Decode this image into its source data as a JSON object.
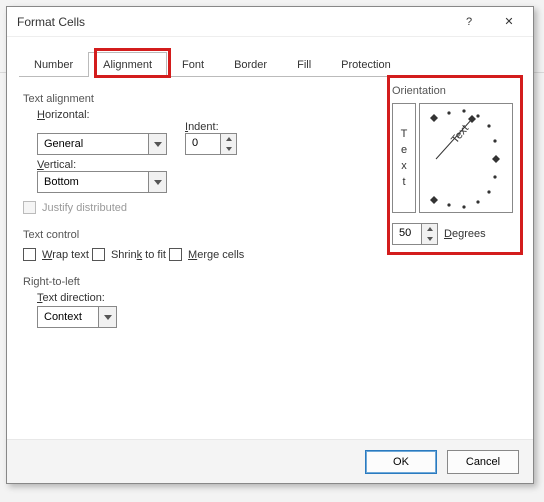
{
  "title": "Format Cells",
  "tabs": [
    "Number",
    "Alignment",
    "Font",
    "Border",
    "Fill",
    "Protection"
  ],
  "active_tab": "Alignment",
  "text_alignment": {
    "section": "Text alignment",
    "horizontal_label": "Horizontal:",
    "horizontal_value": "General",
    "indent_label": "Indent:",
    "indent_value": "0",
    "vertical_label": "Vertical:",
    "vertical_value": "Bottom",
    "justify_label": "Justify distributed"
  },
  "text_control": {
    "section": "Text control",
    "wrap": "Wrap text",
    "shrink": "Shrink to fit",
    "merge": "Merge cells"
  },
  "rtl": {
    "section": "Right-to-left",
    "label": "Text direction:",
    "value": "Context"
  },
  "orientation": {
    "section": "Orientation",
    "vertical_word": [
      "T",
      "e",
      "x",
      "t"
    ],
    "arc_word": "Text",
    "degrees_value": "50",
    "degrees_label": "Degrees"
  },
  "buttons": {
    "ok": "OK",
    "cancel": "Cancel"
  }
}
